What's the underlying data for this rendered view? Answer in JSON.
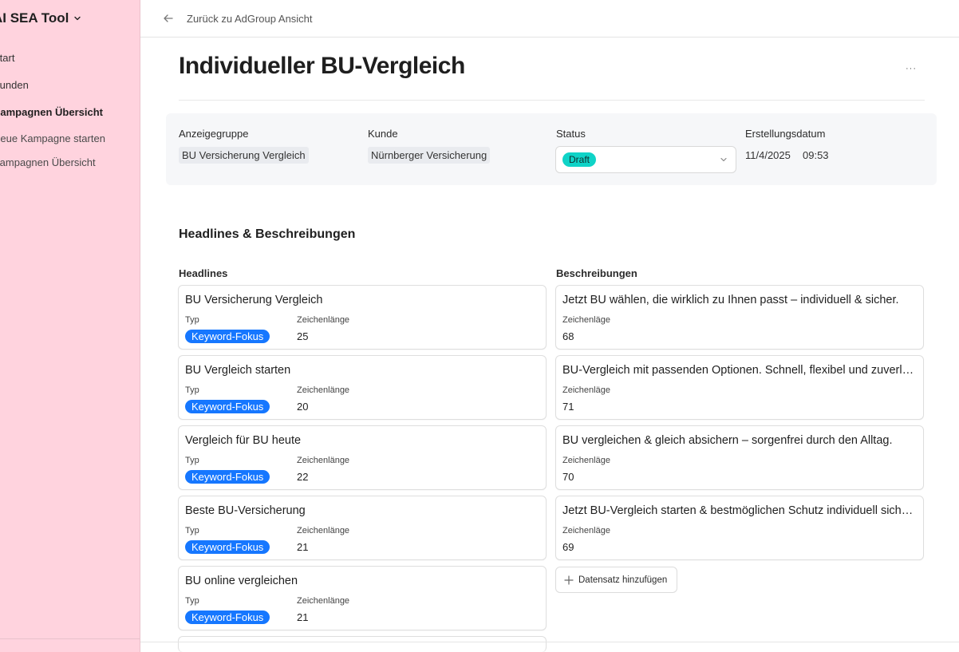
{
  "sidebar": {
    "title": "AI SEA Tool",
    "items": [
      {
        "label": "Start"
      },
      {
        "label": "Kunden"
      },
      {
        "label": "Kampagnen Übersicht"
      },
      {
        "label": "Neue Kampagne starten"
      },
      {
        "label": "Kampagnen Übersicht"
      }
    ]
  },
  "topbar": {
    "back_label": "Zurück zu AdGroup Ansicht"
  },
  "page": {
    "title": "Individueller BU-Vergleich",
    "more_label": "···"
  },
  "meta": {
    "adgroup_label": "Anzeigegruppe",
    "adgroup_value": "BU Versicherung Vergleich",
    "customer_label": "Kunde",
    "customer_value": "Nürnberger Versicherung",
    "status_label": "Status",
    "status_value": "Draft",
    "created_label": "Erstellungsdatum",
    "created_date": "11/4/2025",
    "created_time": "09:53"
  },
  "section": {
    "title": "Headlines & Beschreibungen",
    "headlines_label": "Headlines",
    "descriptions_label": "Beschreibungen",
    "type_label": "Typ",
    "length_label": "Zeichenlänge",
    "length_label_desc": "Zeichenläge"
  },
  "headlines": [
    {
      "text": "BU Versicherung Vergleich",
      "type": "Keyword-Fokus",
      "length": "25"
    },
    {
      "text": "BU Vergleich starten",
      "type": "Keyword-Fokus",
      "length": "20"
    },
    {
      "text": "Vergleich für BU heute",
      "type": "Keyword-Fokus",
      "length": "22"
    },
    {
      "text": "Beste BU-Versicherung",
      "type": "Keyword-Fokus",
      "length": "21"
    },
    {
      "text": "BU online vergleichen",
      "type": "Keyword-Fokus",
      "length": "21"
    }
  ],
  "descriptions": [
    {
      "text": "Jetzt BU wählen, die wirklich zu Ihnen passt – individuell & sicher.",
      "length": "68"
    },
    {
      "text": "BU-Vergleich mit passenden Optionen. Schnell, flexibel und zuverlässig.",
      "length": "71"
    },
    {
      "text": "BU vergleichen & gleich absichern – sorgenfrei durch den Alltag.",
      "length": "70"
    },
    {
      "text": "Jetzt BU-Vergleich starten & bestmöglichen Schutz individuell sichern.",
      "length": "69"
    }
  ],
  "add_button": {
    "label": "Datensatz hinzufügen"
  },
  "colors": {
    "sidebar_bg": "#ffd3de",
    "keyword_tag": "#1677ff",
    "status_tag": "#0fd3c7"
  }
}
